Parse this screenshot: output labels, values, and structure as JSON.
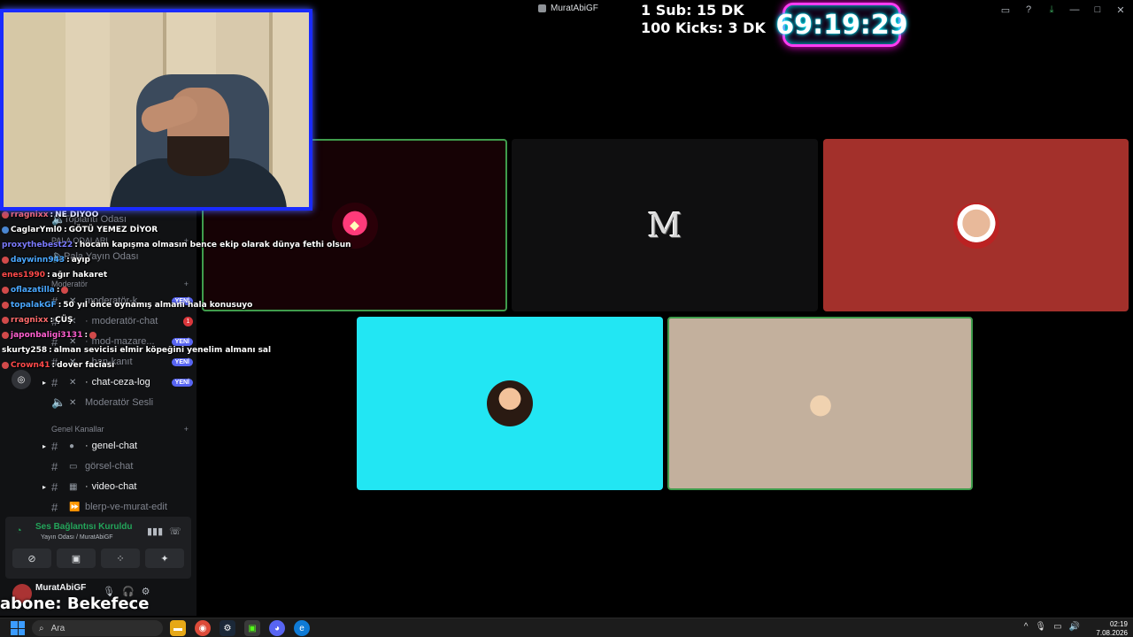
{
  "window": {
    "title": "MuratAbiGF"
  },
  "overlay": {
    "sub_line": "1 Sub: 15 DK",
    "kick_line": "100 Kicks: 3 DK",
    "timer": "69:19:29",
    "abone": "abone: Bekefece"
  },
  "sidebar": {
    "voice_room_1": "Toplantı Odası",
    "category_pala": "PALA ODALARI",
    "voice_room_2": "Pala Yayın Odası",
    "category_moderator": "Moderatör",
    "channels": [
      {
        "label": "moderatör-k...",
        "badge": "YENİ"
      },
      {
        "label": "moderatör-chat",
        "badge": "1"
      },
      {
        "label": "mod-mazare...",
        "badge": "YENİ"
      },
      {
        "label": "ban-kanıt",
        "badge": "YENİ"
      },
      {
        "label": "chat-ceza-log",
        "badge": "YENİ"
      },
      {
        "label": "Moderatör Sesli",
        "badge": ""
      }
    ],
    "category_general": "Genel Kanallar",
    "general_channels": [
      {
        "label": "genel-chat"
      },
      {
        "label": "görsel-chat"
      },
      {
        "label": "video-chat"
      },
      {
        "label": "blerp-ve-murat-edit"
      }
    ]
  },
  "chat": [
    {
      "user": "rragnixx",
      "msg": "NE DİYOO",
      "color": "#ff6b6b"
    },
    {
      "user": "CaglarYml0",
      "msg": "GÖTÜ YEMEZ DİYOR",
      "color": "#ffffff"
    },
    {
      "user": "proxythebest22",
      "msg": "hocam kapışma olmasın bence ekip olarak dünya fethi olsun",
      "color": "#7b7bff"
    },
    {
      "user": "daywinn943",
      "msg": "ayıp",
      "color": "#4aa8ff"
    },
    {
      "user": "enes1990",
      "msg": "ağır hakaret",
      "color": "#ff4a4a"
    },
    {
      "user": "oflazatilla",
      "msg": "",
      "color": "#4aa8ff"
    },
    {
      "user": "topalakGF",
      "msg": "50 yıl önce oynamış almanı hala konusuyo",
      "color": "#4aa8ff"
    },
    {
      "user": "rragnixx",
      "msg": "ÇÜŞ",
      "color": "#ff6b6b"
    },
    {
      "user": "japonbaligi3131",
      "msg": "",
      "color": "#ff5fd0"
    },
    {
      "user": "skurty258",
      "msg": "alman sevicisi elmir köpeğini yenelim almanı sal",
      "color": "#ffffff"
    },
    {
      "user": "Crown41",
      "msg": "dover faciası",
      "color": "#ff4a4a"
    }
  ],
  "voice_panel": {
    "status": "Ses Bağlantısı Kuruldu",
    "room": "Yayın Odası / MuratAbiGF"
  },
  "user_panel": {
    "name": "MuratAbiGF"
  },
  "tiles": [
    {
      "name": "demon-avatar",
      "speaking": true
    },
    {
      "name": "m-avatar",
      "letter": "M",
      "speaking": false
    },
    {
      "name": "boy-avatar",
      "speaking": false
    },
    {
      "name": "sunglasses-avatar",
      "speaking": false
    },
    {
      "name": "king-avatar",
      "speaking": true
    }
  ],
  "taskbar": {
    "search_placeholder": "Ara",
    "time": "02:19",
    "date": "7.08.2026"
  },
  "colors": {
    "speaking_border": "#3f9c4c",
    "tile_red": "#a3302b",
    "tile_cyan": "#22e6f3",
    "tile_beige": "#c3b09d",
    "webcam_border": "#1a2bff",
    "timer_glow": "#ff3df2"
  }
}
